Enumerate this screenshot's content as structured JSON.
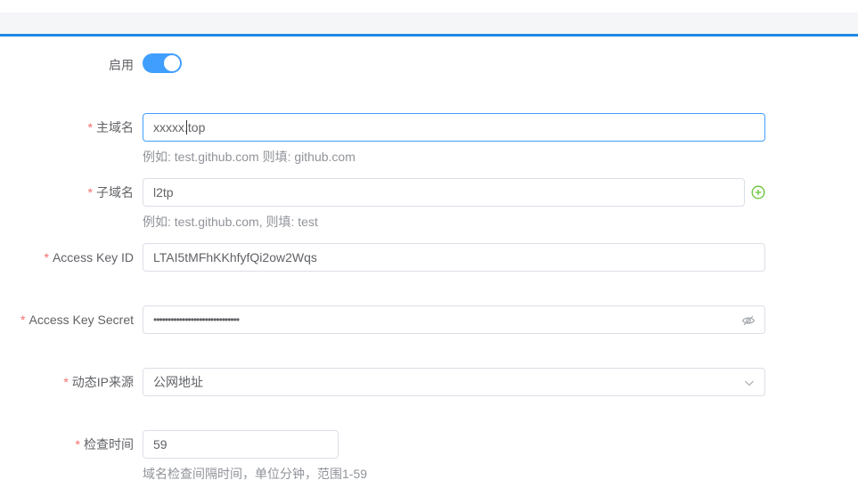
{
  "form": {
    "enable": {
      "label": "启用",
      "on": true
    },
    "main_domain": {
      "label": "主域名",
      "value": "xxxxx.top",
      "hint": "例如: test.github.com 则填: github.com"
    },
    "sub_domain": {
      "label": "子域名",
      "value": "l2tp",
      "hint": "例如: test.github.com, 则填: test",
      "add_icon": "plus-circle-icon"
    },
    "access_key_id": {
      "label": "Access Key ID",
      "value": "LTAI5tMFhKKhfyfQi2ow2Wqs"
    },
    "access_key_secret": {
      "label": "Access Key Secret",
      "value": "••••••••••••••••••••••••••••••",
      "toggle_icon": "eye-slash-icon"
    },
    "ip_source": {
      "label": "动态IP来源",
      "value": "公网地址",
      "icon": "chevron-down-icon"
    },
    "check_interval": {
      "label": "检查时间",
      "value": "59",
      "hint": "域名检查间隔时间，单位分钟，范围1-59"
    },
    "required_mark": "*"
  },
  "colors": {
    "accent": "#409eff",
    "required": "#f56c6c",
    "topline": "#1e88e5",
    "add_icon": "#67c23a"
  }
}
